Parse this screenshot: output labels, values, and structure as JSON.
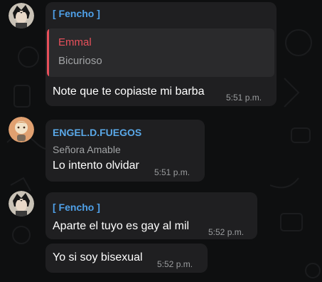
{
  "colors": {
    "fencho_name": "#4fa0e8",
    "engel_name": "#5aa8e8",
    "reply_accent": "#e8505b",
    "reply_name": "#e8505b"
  },
  "messages": [
    {
      "sender": "[ Fencho ]",
      "reply": {
        "name": "Emmal",
        "text": "Bicurioso"
      },
      "text": "Note que te copiaste mi barba",
      "time": "5:51 p.m."
    },
    {
      "sender": "ENGEL.D.FUEGOS",
      "title": "Señora Amable",
      "text": "Lo intento olvidar",
      "time": "5:51 p.m."
    },
    {
      "sender": "[ Fencho ]",
      "text": "Aparte el tuyo es gay al mil",
      "time": "5:52 p.m."
    },
    {
      "text": "Yo si soy bisexual",
      "time": "5:52 p.m."
    }
  ]
}
